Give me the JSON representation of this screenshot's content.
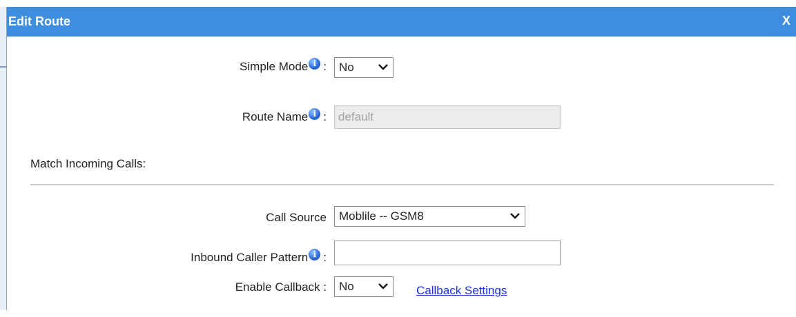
{
  "dialog": {
    "title": "Edit Route",
    "close_label": "X"
  },
  "simple_mode": {
    "label": "Simple Mode",
    "colon": ":",
    "value": "No"
  },
  "route_name": {
    "label": "Route Name",
    "colon": ":",
    "value": "default"
  },
  "match_section": {
    "heading": "Match Incoming Calls:"
  },
  "call_source": {
    "label": "Call Source",
    "value": "Moblile -- GSM8"
  },
  "inbound_caller_pattern": {
    "label": "Inbound Caller Pattern",
    "colon": ":",
    "value": ""
  },
  "enable_callback": {
    "label": "Enable Callback :",
    "value": "No",
    "link_label": "Callback Settings"
  },
  "icons": {
    "info": "info-icon",
    "dropdown": "chevron-down-icon"
  },
  "colors": {
    "titlebar": "#3d8ede",
    "link": "#1a2fe0"
  }
}
